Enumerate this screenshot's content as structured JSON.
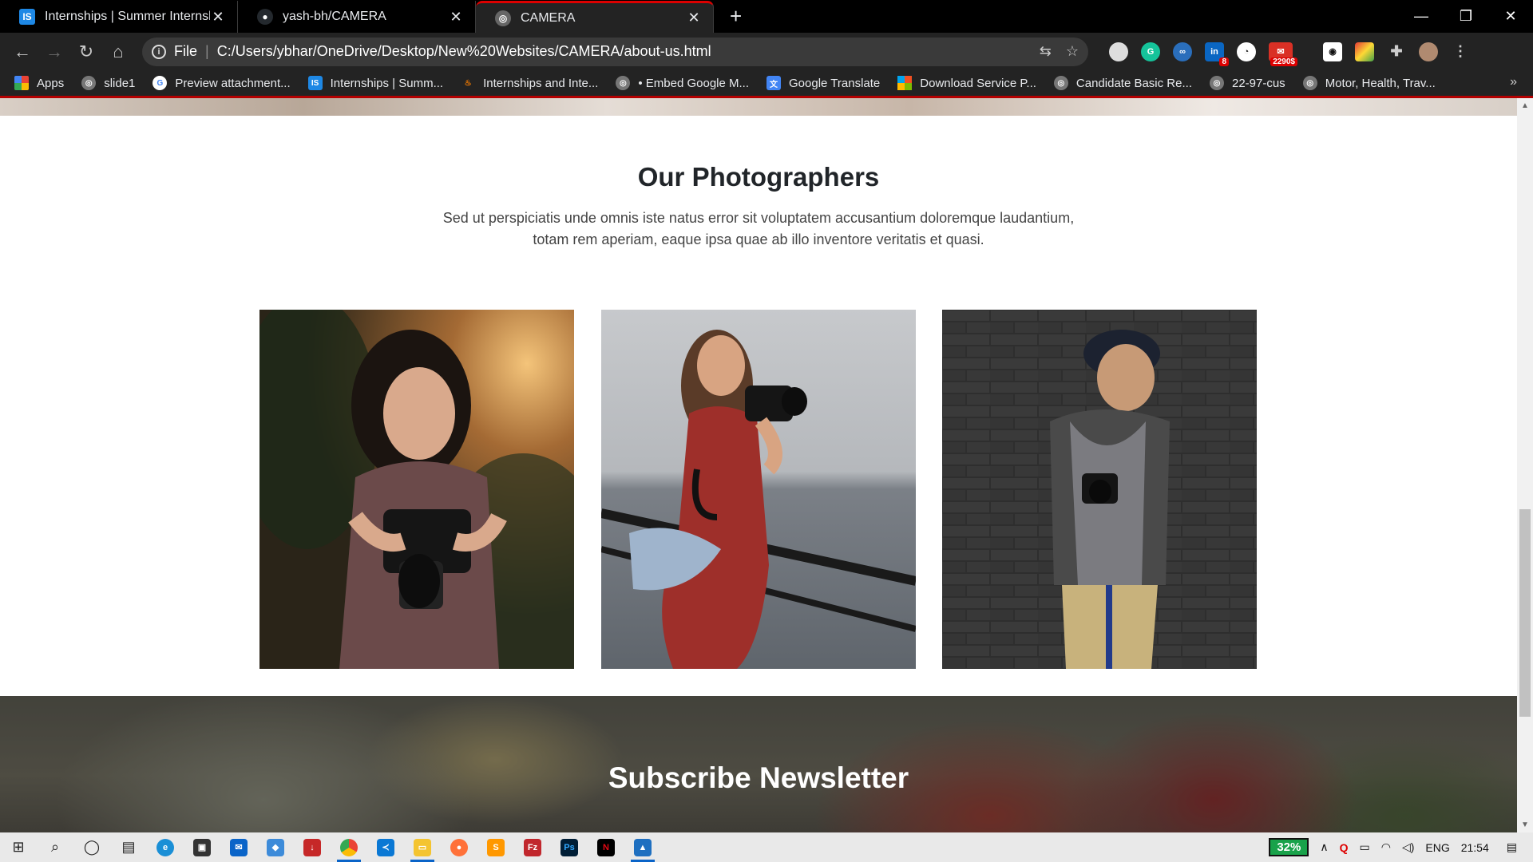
{
  "browser": {
    "tabs": [
      {
        "title": "Internships | Summer Internship",
        "favicon": "IS",
        "favicon_color": "#1e88e5",
        "active": false
      },
      {
        "title": "yash-bh/CAMERA",
        "favicon": "github-icon",
        "favicon_color": "#24292e",
        "active": false
      },
      {
        "title": "CAMERA",
        "favicon": "globe-icon",
        "favicon_color": "#555",
        "active": true
      }
    ],
    "address": {
      "scheme": "File",
      "url": "C:/Users/ybhar/OneDrive/Desktop/New%20Websites/CAMERA/about-us.html"
    },
    "extension_badges": {
      "linkedin": "8",
      "mail": "2290$"
    },
    "bookmarks": [
      {
        "label": "Apps",
        "icon": "apps-grid-icon"
      },
      {
        "label": "slide1",
        "icon": "globe-icon"
      },
      {
        "label": "Preview attachment...",
        "icon": "google-icon"
      },
      {
        "label": "Internships | Summ...",
        "icon": "IS"
      },
      {
        "label": "Internships and Inte...",
        "icon": "flame-icon"
      },
      {
        "label": "• Embed Google M...",
        "icon": "globe-icon"
      },
      {
        "label": "Google Translate",
        "icon": "translate-icon"
      },
      {
        "label": "Download Service P...",
        "icon": "microsoft-icon"
      },
      {
        "label": "Candidate Basic Re...",
        "icon": "globe-icon"
      },
      {
        "label": "22-97-cus",
        "icon": "globe-icon"
      },
      {
        "label": "Motor, Health, Trav...",
        "icon": "globe-icon"
      }
    ]
  },
  "page": {
    "section_title": "Our Photographers",
    "section_desc": "Sed ut perspiciatis unde omnis iste natus error sit voluptatem accusantium doloremque laudantium, totam rem aperiam, eaque ipsa quae ab illo inventore veritatis et quasi.",
    "photographers": [
      {
        "alt": "woman-with-camera-photo"
      },
      {
        "alt": "woman-on-pier-photo"
      },
      {
        "alt": "man-by-brick-wall-photo"
      }
    ],
    "newsletter_title": "Subscribe Newsletter"
  },
  "taskbar": {
    "battery": "32%",
    "language": "ENG",
    "time": "21:54"
  }
}
